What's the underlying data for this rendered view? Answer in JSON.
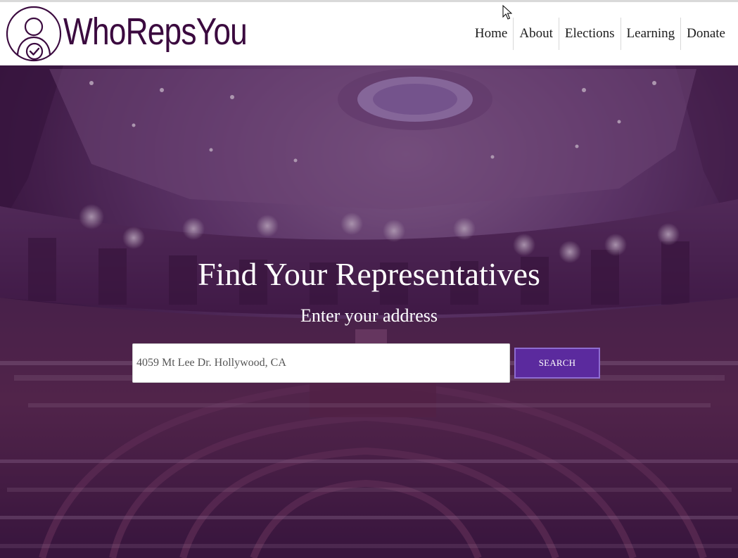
{
  "brand": {
    "name": "WhoRepsYou",
    "icon": "user-check-icon",
    "color": "#3b0a3f"
  },
  "nav": {
    "items": [
      {
        "label": "Home"
      },
      {
        "label": "About"
      },
      {
        "label": "Elections"
      },
      {
        "label": "Learning"
      },
      {
        "label": "Donate"
      }
    ]
  },
  "hero": {
    "background": "congress-chamber-photo",
    "overlay_color": "#46164e",
    "title": "Find Your Representatives",
    "subtitle": "Enter your address",
    "search": {
      "value": "",
      "placeholder": "4059 Mt Lee Dr. Hollywood, CA",
      "button_label": "Search",
      "button_color": "#5b2a9e"
    }
  }
}
